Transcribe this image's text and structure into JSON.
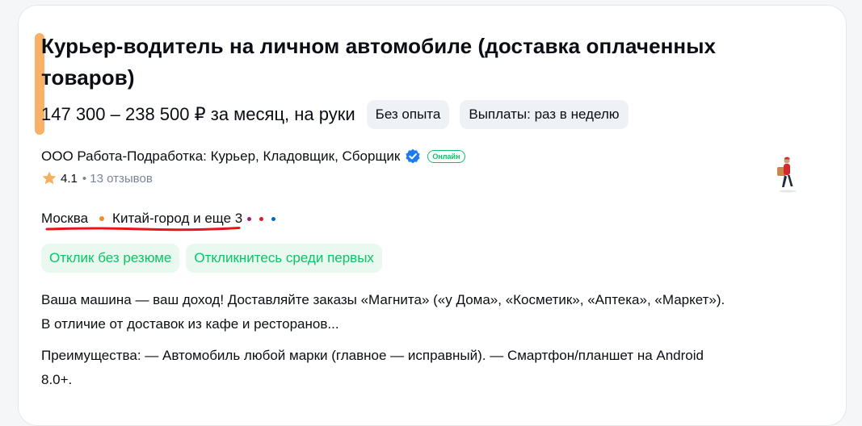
{
  "vacancy": {
    "title": "Курьер-водитель на личном автомобиле (доставка оплаченных товаров)",
    "salary": "147 300 – 238 500 ₽ за месяц, на руки",
    "tags": [
      "Без опыта",
      "Выплаты: раз в неделю"
    ],
    "employer": "ООО Работа-Подработка: Курьер, Кладовщик, Сборщик",
    "online_badge": "Онлайн",
    "rating": "4.1",
    "reviews": "13 отзывов",
    "city": "Москва",
    "metro": "Китай-город и еще 3",
    "responses": [
      "Отклик без резюме",
      "Откликнитесь среди первых"
    ],
    "description": [
      "Ваша машина — ваш доход! Доставляйте заказы «Магнита» («у Дома», «Косметик», «Аптека», «Маркет»).",
      "В отличие от доставок из кафе и ресторанов...",
      "Преимущества: — Автомобиль любой марки (главное — исправный). — Смартфон/планшет на Android",
      "8.0+."
    ]
  },
  "colors": {
    "accent_bar": "#f7b267",
    "verified": "#1b7cf2",
    "online": "#0dc267",
    "metro_primary": "#f28c28",
    "metro_lines": [
      "#a01e7c",
      "#e01b24",
      "#0068b4"
    ],
    "annotation_underline": "#e8141c"
  },
  "icons": {
    "verified": "verified-check-icon",
    "star": "star-icon",
    "avatar": "courier-avatar"
  }
}
